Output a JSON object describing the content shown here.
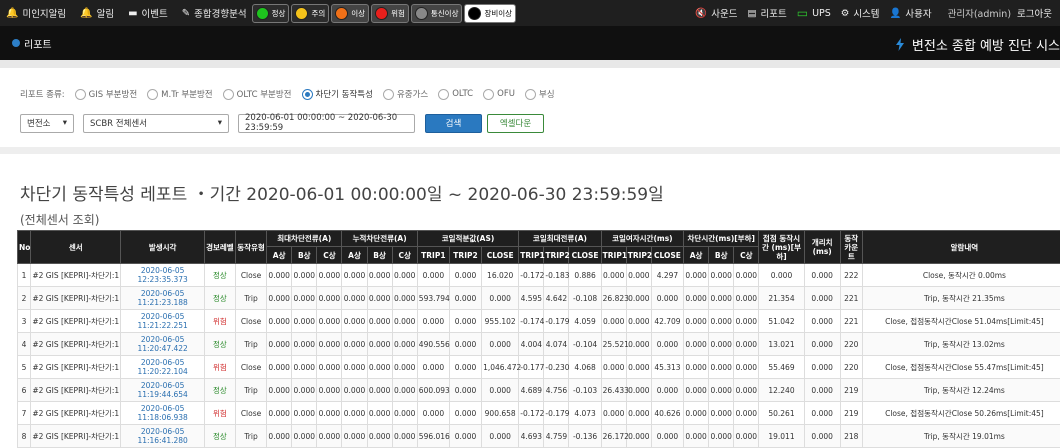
{
  "topbar": {
    "items": [
      {
        "label": "미인지알림",
        "icon": "bell-outline-icon"
      },
      {
        "label": "알림",
        "icon": "bell-icon"
      },
      {
        "label": "이벤트",
        "icon": "message-icon"
      },
      {
        "label": "종합경향분석",
        "icon": "pen-icon"
      }
    ],
    "statuses": [
      {
        "label": "정상",
        "color": "#1ec41e"
      },
      {
        "label": "주의",
        "color": "#f4c21a"
      },
      {
        "label": "이상",
        "color": "#f07018"
      },
      {
        "label": "위험",
        "color": "#e8201c"
      },
      {
        "label": "통신이상",
        "color": "#888888"
      },
      {
        "label": "장비이상",
        "color": "#000000"
      }
    ],
    "right": [
      {
        "label": "사운드",
        "icon": "speaker-mute-icon"
      },
      {
        "label": "리포트",
        "icon": "report-icon"
      },
      {
        "label": "UPS",
        "icon": "battery-icon"
      },
      {
        "label": "시스템",
        "icon": "gear-icon"
      },
      {
        "label": "사용자",
        "icon": "user-icon"
      }
    ],
    "admin": "관리자(admin)",
    "logout": "로그아웃"
  },
  "subbar": {
    "title": "리포트",
    "system_title": "변전소 종합 예방 진단 시스"
  },
  "filter": {
    "type_label": "리포트 종류:",
    "types": [
      {
        "label": "GIS 부분방전",
        "selected": false
      },
      {
        "label": "M.Tr 부분방전",
        "selected": false
      },
      {
        "label": "OLTC 부분방전",
        "selected": false
      },
      {
        "label": "차단기 동작특성",
        "selected": true
      },
      {
        "label": "유중가스",
        "selected": false
      },
      {
        "label": "OLTC",
        "selected": false
      },
      {
        "label": "OFU",
        "selected": false
      },
      {
        "label": "부싱",
        "selected": false
      }
    ],
    "substation": "변전소",
    "sensor": "SCBR 전체센서",
    "date_range": "2020-06-01 00:00:00 ~ 2020-06-30 23:59:59",
    "search": "검색",
    "excel": "엑셀다운"
  },
  "report": {
    "title": "차단기 동작특성 레포트 ・기간 2020-06-01 00:00:00일 ~ 2020-06-30 23:59:59일",
    "subtitle": "(전체센서 조회)"
  },
  "table": {
    "headers_top": [
      "No",
      "센서",
      "발생시각",
      "경보레벨",
      "동작유형",
      "최대차단전류(A)",
      "누적차단전류(A)",
      "코일적분값(AS)",
      "코일최대전류(A)",
      "코일여자시간(ms)",
      "차단시간(ms)[부하]",
      "접점 동작시간 (ms)[부하]",
      "개리치 (ms)",
      "동작카운트",
      "알람내역"
    ],
    "headers_sub": [
      "A상",
      "B상",
      "C상",
      "A상",
      "B상",
      "C상",
      "TRIP1",
      "TRIP2",
      "CLOSE",
      "TRIP1",
      "TRIP2",
      "CLOSE",
      "TRIP1",
      "TRIP2",
      "CLOSE",
      "A상",
      "B상",
      "C상"
    ],
    "rows": [
      [
        "1",
        "#2 GIS [KEPRI]-차단기:1",
        "2020-06-05 12:23:35.373",
        "정상",
        "Close",
        "0.000",
        "0.000",
        "0.000",
        "0.000",
        "0.000",
        "0.000",
        "0.000",
        "0.000",
        "16.020",
        "-0.172",
        "-0.183",
        "0.886",
        "0.000",
        "0.000",
        "4.297",
        "0.000",
        "0.000",
        "0.000",
        "0.000",
        "0.000",
        "222",
        "Close, 동작시간 0.00ms"
      ],
      [
        "2",
        "#2 GIS [KEPRI]-차단기:1",
        "2020-06-05 11:21:23.188",
        "정상",
        "Trip",
        "0.000",
        "0.000",
        "0.000",
        "0.000",
        "0.000",
        "0.000",
        "593.794",
        "0.000",
        "0.000",
        "4.595",
        "4.642",
        "-0.108",
        "26.823",
        "0.000",
        "0.000",
        "0.000",
        "0.000",
        "0.000",
        "21.354",
        "0.000",
        "221",
        "Trip, 동작시간 21.35ms"
      ],
      [
        "3",
        "#2 GIS [KEPRI]-차단기:1",
        "2020-06-05 11:21:22.251",
        "위험",
        "Close",
        "0.000",
        "0.000",
        "0.000",
        "0.000",
        "0.000",
        "0.000",
        "0.000",
        "0.000",
        "955.102",
        "-0.174",
        "-0.179",
        "4.059",
        "0.000",
        "0.000",
        "42.709",
        "0.000",
        "0.000",
        "0.000",
        "51.042",
        "0.000",
        "221",
        "Close, 접점동작시간Close 51.04ms[Limit:45]"
      ],
      [
        "4",
        "#2 GIS [KEPRI]-차단기:1",
        "2020-06-05 11:20:47.422",
        "정상",
        "Trip",
        "0.000",
        "0.000",
        "0.000",
        "0.000",
        "0.000",
        "0.000",
        "490.556",
        "0.000",
        "0.000",
        "4.004",
        "4.074",
        "-0.104",
        "25.521",
        "0.000",
        "0.000",
        "0.000",
        "0.000",
        "0.000",
        "13.021",
        "0.000",
        "220",
        "Trip, 동작시간 13.02ms"
      ],
      [
        "5",
        "#2 GIS [KEPRI]-차단기:1",
        "2020-06-05 11:20:22.104",
        "위험",
        "Close",
        "0.000",
        "0.000",
        "0.000",
        "0.000",
        "0.000",
        "0.000",
        "0.000",
        "0.000",
        "1,046.472",
        "-0.177",
        "-0.230",
        "4.068",
        "0.000",
        "0.000",
        "45.313",
        "0.000",
        "0.000",
        "0.000",
        "55.469",
        "0.000",
        "220",
        "Close, 접점동작시간Close 55.47ms[Limit:45]"
      ],
      [
        "6",
        "#2 GIS [KEPRI]-차단기:1",
        "2020-06-05 11:19:44.654",
        "정상",
        "Trip",
        "0.000",
        "0.000",
        "0.000",
        "0.000",
        "0.000",
        "0.000",
        "600.093",
        "0.000",
        "0.000",
        "4.689",
        "4.756",
        "-0.103",
        "26.433",
        "0.000",
        "0.000",
        "0.000",
        "0.000",
        "0.000",
        "12.240",
        "0.000",
        "219",
        "Trip, 동작시간 12.24ms"
      ],
      [
        "7",
        "#2 GIS [KEPRI]-차단기:1",
        "2020-06-05 11:18:06.938",
        "위험",
        "Close",
        "0.000",
        "0.000",
        "0.000",
        "0.000",
        "0.000",
        "0.000",
        "0.000",
        "0.000",
        "900.658",
        "-0.172",
        "-0.179",
        "4.073",
        "0.000",
        "0.000",
        "40.626",
        "0.000",
        "0.000",
        "0.000",
        "50.261",
        "0.000",
        "219",
        "Close, 접점동작시간Close 50.26ms[Limit:45]"
      ],
      [
        "8",
        "#2 GIS [KEPRI]-차단기:1",
        "2020-06-05 11:16:41.280",
        "정상",
        "Trip",
        "0.000",
        "0.000",
        "0.000",
        "0.000",
        "0.000",
        "0.000",
        "596.016",
        "0.000",
        "0.000",
        "4.693",
        "4.759",
        "-0.136",
        "26.172",
        "0.000",
        "0.000",
        "0.000",
        "0.000",
        "0.000",
        "19.011",
        "0.000",
        "218",
        "Trip, 동작시간 19.01ms"
      ]
    ]
  }
}
